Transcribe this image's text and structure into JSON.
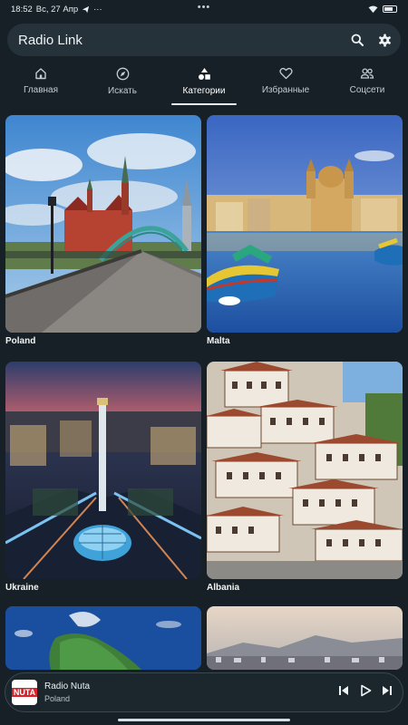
{
  "status_bar": {
    "time": "18:52",
    "date": "Вс, 27 Апр",
    "extra": "···"
  },
  "search_bar": {
    "title": "Radio Link"
  },
  "tabs": [
    {
      "label": "Главная",
      "icon": "home-icon",
      "active": false
    },
    {
      "label": "Искать",
      "icon": "compass-icon",
      "active": false
    },
    {
      "label": "Категории",
      "icon": "shapes-icon",
      "active": true
    },
    {
      "label": "Избранные",
      "icon": "heart-icon",
      "active": false
    },
    {
      "label": "Соцсети",
      "icon": "people-icon",
      "active": false
    }
  ],
  "categories": [
    {
      "label": "Poland"
    },
    {
      "label": "Malta"
    },
    {
      "label": "Ukraine"
    },
    {
      "label": "Albania"
    },
    {
      "label": ""
    },
    {
      "label": ""
    }
  ],
  "player": {
    "logo_text": "NUTA",
    "station": "Radio Nuta",
    "country": "Poland"
  },
  "colors": {
    "background": "#172026",
    "surface": "#25323a",
    "accent": "#e8eef1"
  }
}
